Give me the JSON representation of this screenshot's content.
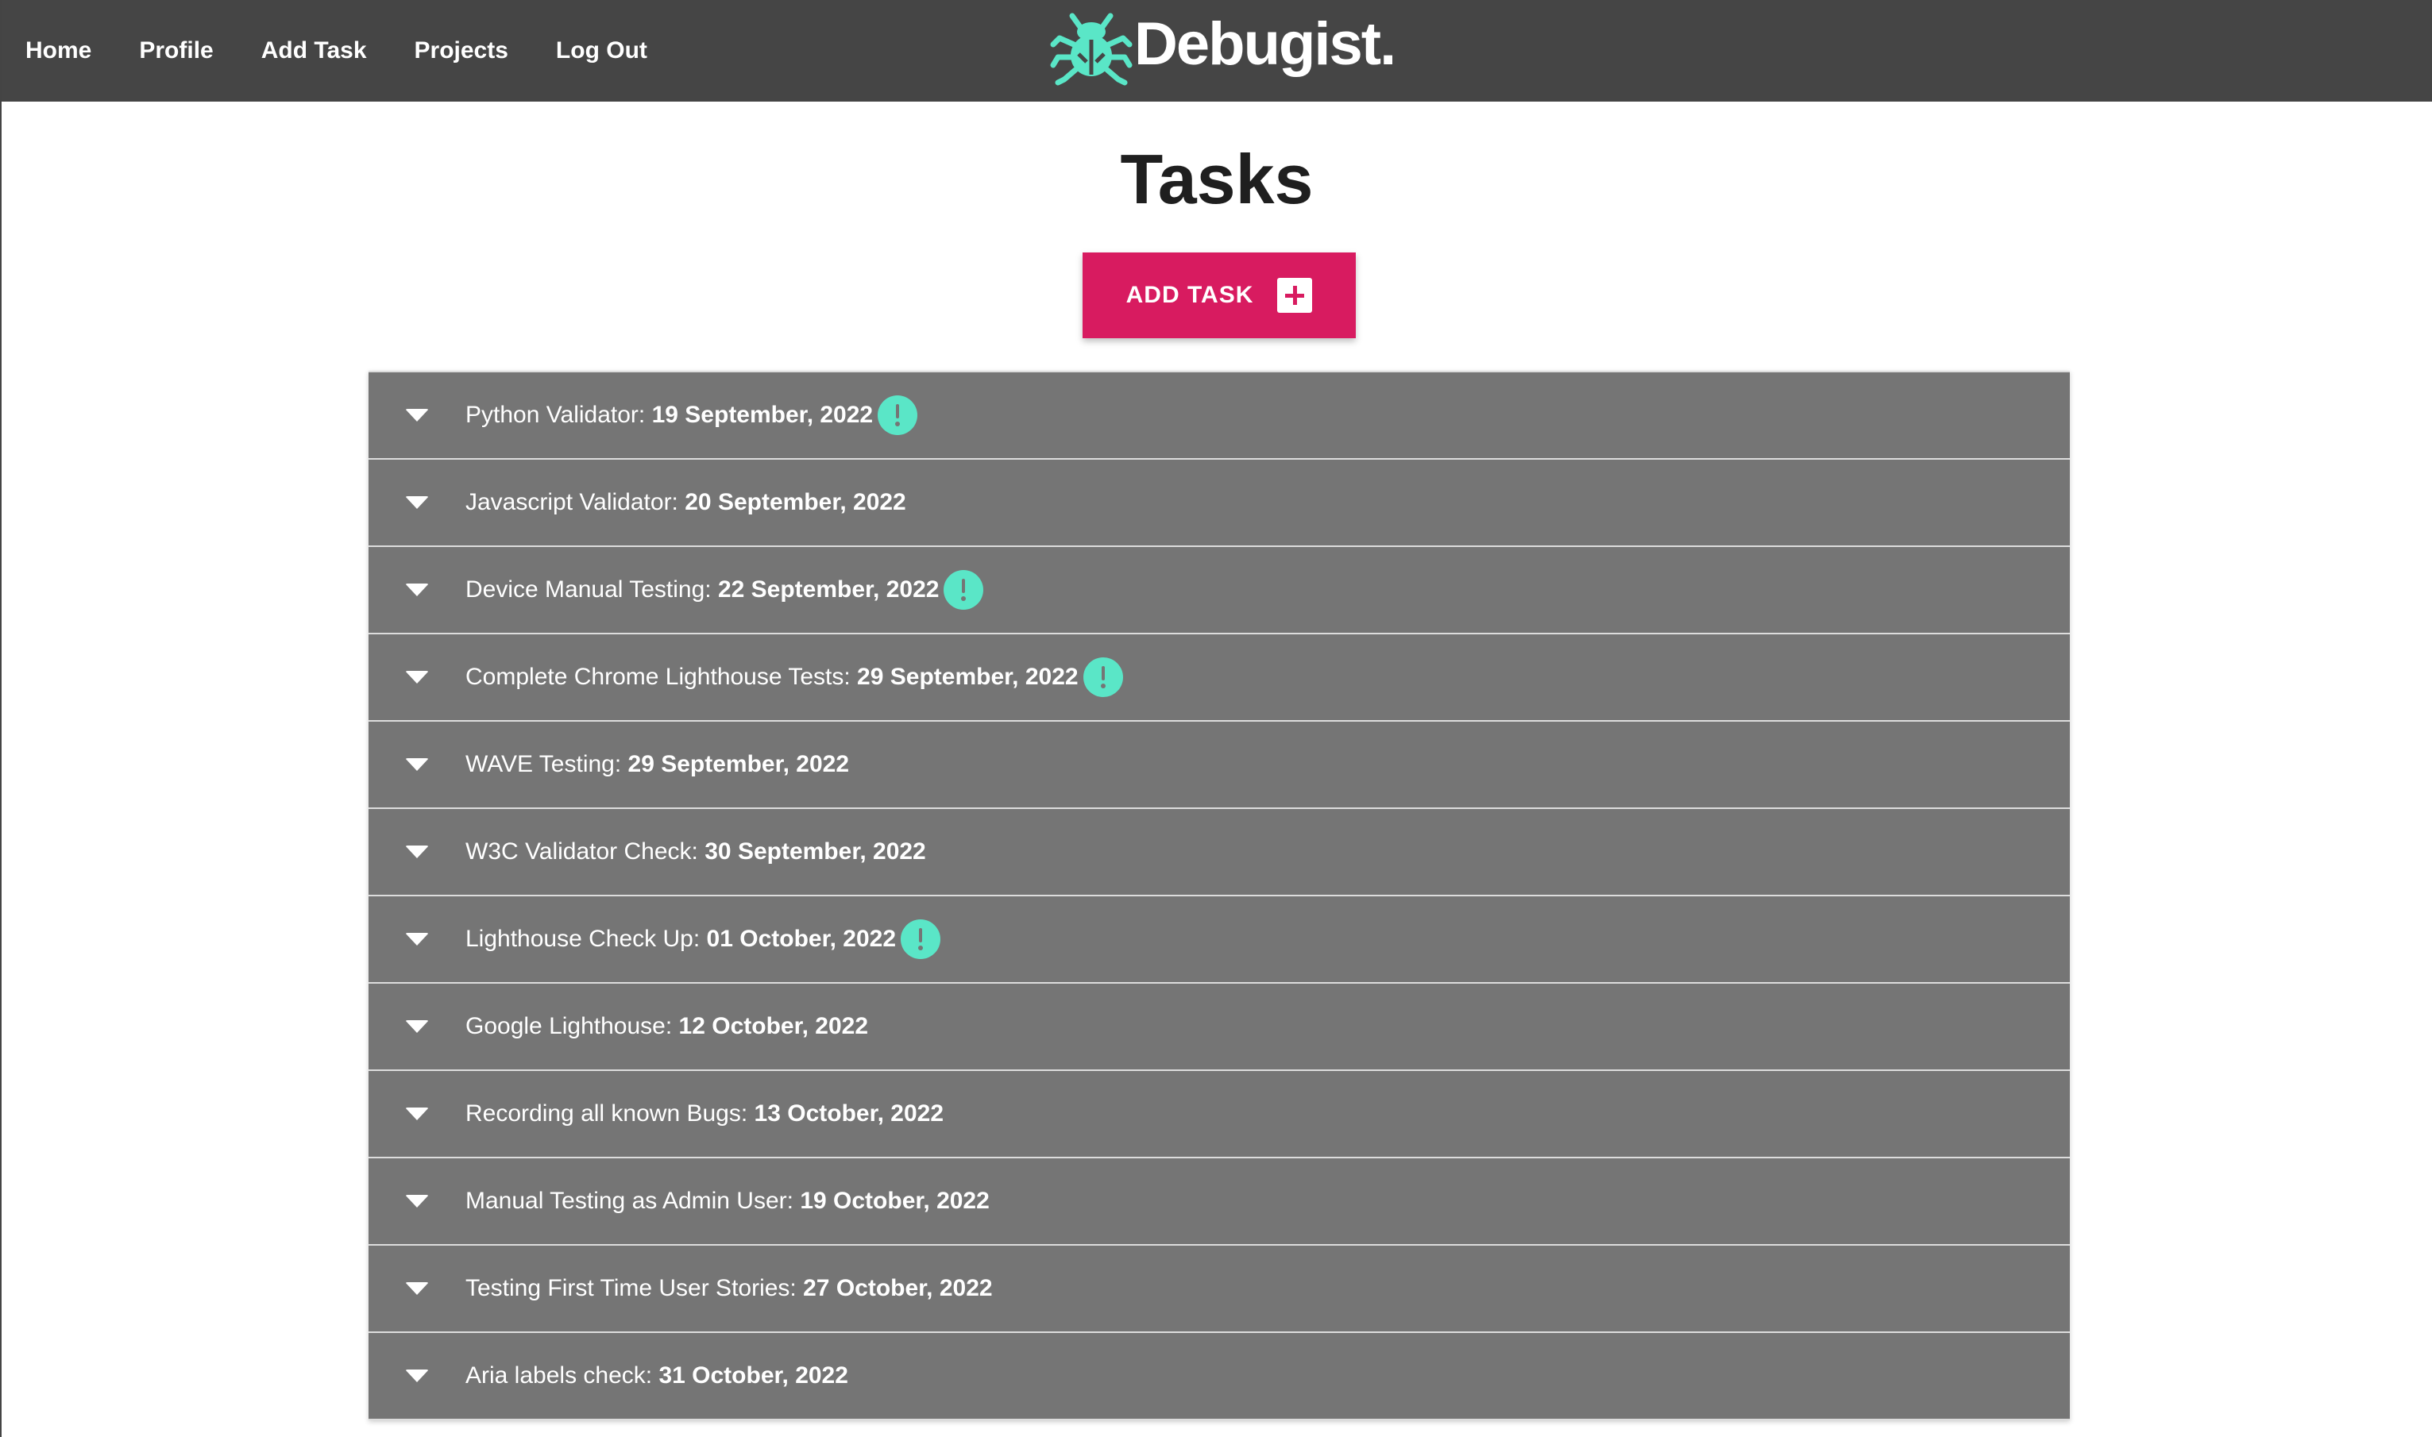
{
  "nav": {
    "links": [
      "Home",
      "Profile",
      "Add Task",
      "Projects",
      "Log Out"
    ]
  },
  "brand": {
    "name": "Debugist.",
    "logo_icon": "bug-icon",
    "logo_color": "#5ae6c7"
  },
  "page": {
    "title": "Tasks"
  },
  "add_button": {
    "label": "ADD TASK",
    "icon": "plus-square-icon",
    "color": "#d81b60"
  },
  "tasks": [
    {
      "name": "Python Validator:",
      "date": "19 September, 2022",
      "alert": true
    },
    {
      "name": "Javascript Validator:",
      "date": "20 September, 2022",
      "alert": false
    },
    {
      "name": "Device Manual Testing:",
      "date": "22 September, 2022",
      "alert": true
    },
    {
      "name": "Complete Chrome Lighthouse Tests:",
      "date": "29 September, 2022",
      "alert": true
    },
    {
      "name": "WAVE Testing:",
      "date": "29 September, 2022",
      "alert": false
    },
    {
      "name": "W3C Validator Check:",
      "date": "30 September, 2022",
      "alert": false
    },
    {
      "name": "Lighthouse Check Up:",
      "date": "01 October, 2022",
      "alert": true
    },
    {
      "name": "Google Lighthouse:",
      "date": "12 October, 2022",
      "alert": false
    },
    {
      "name": "Recording all known Bugs:",
      "date": "13 October, 2022",
      "alert": false
    },
    {
      "name": "Manual Testing as Admin User:",
      "date": "19 October, 2022",
      "alert": false
    },
    {
      "name": "Testing First Time User Stories:",
      "date": "27 October, 2022",
      "alert": false
    },
    {
      "name": "Aria labels check:",
      "date": "31 October, 2022",
      "alert": false
    }
  ],
  "colors": {
    "navbar": "#454545",
    "task_row": "#757575",
    "alert": "#5ae6c7"
  }
}
